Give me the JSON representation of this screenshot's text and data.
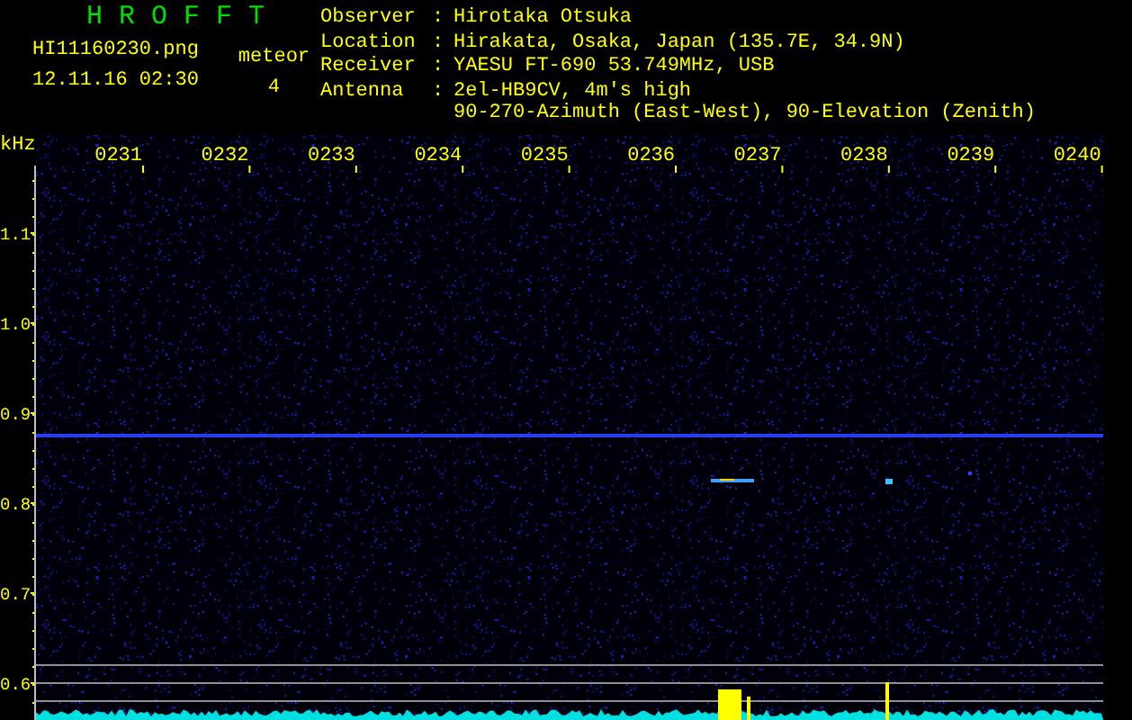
{
  "title": "H R O F F T",
  "file": {
    "name": "HI11160230.png",
    "datetime": "12.11.16 02:30"
  },
  "meteor": {
    "label": "meteor",
    "count": "4"
  },
  "info": [
    {
      "label": "Observer",
      "separator": ":",
      "values": [
        "Hirotaka Otsuka"
      ]
    },
    {
      "label": "Location",
      "separator": ":",
      "values": [
        "Hirakata, Osaka, Japan (135.7E, 34.9N)"
      ]
    },
    {
      "label": "Receiver",
      "separator": ":",
      "values": [
        "YAESU FT-690 53.749MHz, USB"
      ]
    },
    {
      "label": "Antenna",
      "separator": ":",
      "values": [
        "2el-HB9CV, 4m's high",
        "90-270-Azimuth (East-West), 90-Elevation (Zenith)"
      ]
    }
  ],
  "frequency_axis": {
    "unit": "kHz",
    "labels": [
      "1.1",
      "1.0",
      "0.9",
      "0.8",
      "0.7",
      "0.6"
    ]
  },
  "time_axis": {
    "labels": [
      "0231",
      "0232",
      "0233",
      "0234",
      "0235",
      "0236",
      "0237",
      "0238",
      "0239",
      "0240"
    ]
  }
}
